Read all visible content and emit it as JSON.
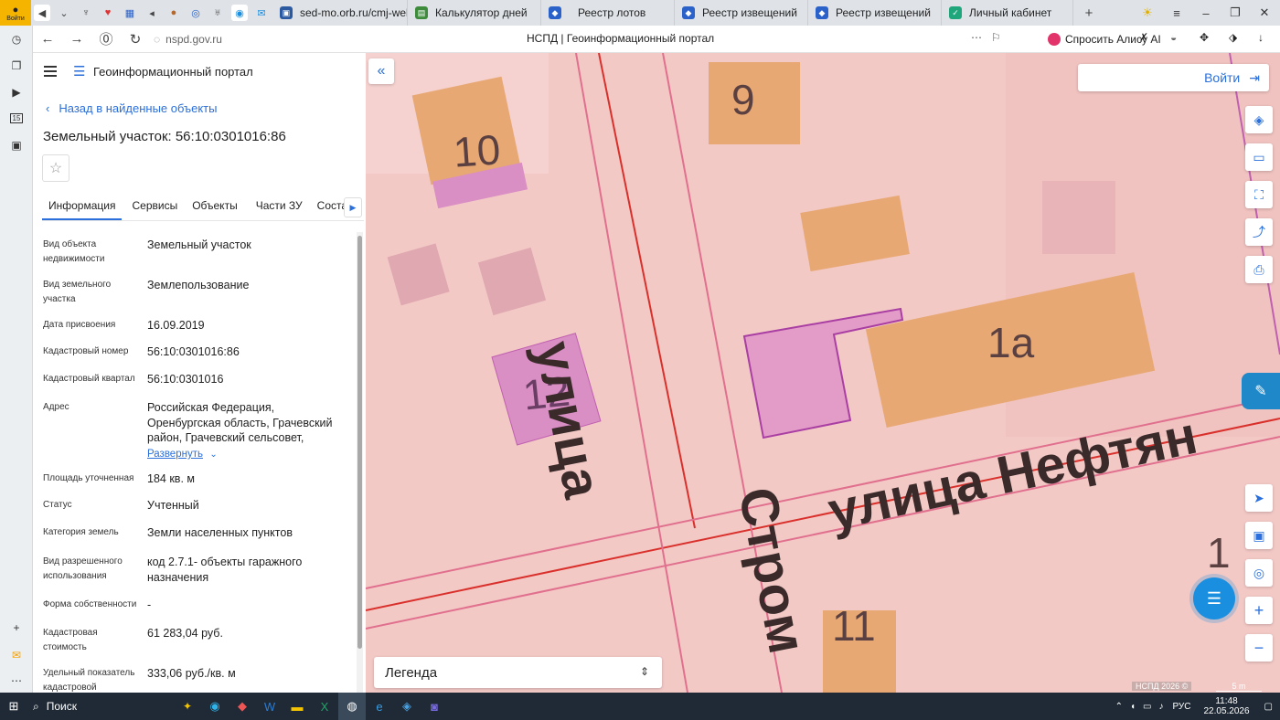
{
  "browser": {
    "profile_label": "Войти",
    "tabs": [
      {
        "label": "sed-mo.orb.ru/cmj-web/?",
        "color": "#2c5aa0"
      },
      {
        "label": "Калькулятор дней",
        "color": "#3c8c3c"
      },
      {
        "label": "Реестр лотов",
        "color": "#2a62c9"
      },
      {
        "label": "Реестр извещений",
        "color": "#2a62c9"
      },
      {
        "label": "Реестр извещений",
        "color": "#2a62c9"
      },
      {
        "label": "Личный кабинет",
        "color": "#1fa67a"
      }
    ],
    "url": "nspd.gov.ru",
    "page_title": "НСПД | Геоинформационный портал",
    "alisa": "Спросить Алису AI",
    "rail_badge": "15"
  },
  "panel": {
    "portal_name": "Геоинформационный портал",
    "back_label": "Назад в найденные объекты",
    "title": "Земельный участок: 56:10:0301016:86",
    "tabs": [
      "Информация",
      "Сервисы",
      "Объекты",
      "Части ЗУ",
      "Состав"
    ],
    "expand_label": "Развернуть",
    "fields": [
      {
        "key": "Вид объекта недвижимости",
        "value": "Земельный участок"
      },
      {
        "key": "Вид земельного участка",
        "value": "Землепользование"
      },
      {
        "key": "Дата присвоения",
        "value": "16.09.2019"
      },
      {
        "key": "Кадастровый номер",
        "value": "56:10:0301016:86"
      },
      {
        "key": "Кадастровый квартал",
        "value": "56:10:0301016"
      },
      {
        "key": "Адрес",
        "value": "Российская Федерация, Оренбургская область, Грачевский район, Грачевский сельсовет,"
      },
      {
        "key": "Площадь уточненная",
        "value": "184 кв. м"
      },
      {
        "key": "Статус",
        "value": "Учтенный"
      },
      {
        "key": "Категория земель",
        "value": "Земли населенных пунктов"
      },
      {
        "key": "Вид разрешенного использования",
        "value": "код 2.7.1- объекты гаражного назначения"
      },
      {
        "key": "Форма собственности",
        "value": "-"
      },
      {
        "key": "Кадастровая стоимость",
        "value": "61 283,04 руб."
      },
      {
        "key": "Удельный показатель кадастровой",
        "value": "333,06 руб./кв. м"
      }
    ]
  },
  "map": {
    "login_label": "Войти",
    "legend_label": "Легенда",
    "copyright": "НСПД 2026 ©",
    "scale_label": "5 m",
    "labels": {
      "n9": "9",
      "n10": "10",
      "n12": "12",
      "n1a": "1а",
      "n11": "11",
      "n1": "1",
      "street1": "улица",
      "street2": "Стром",
      "street3": "улица Нефтян"
    },
    "colors": {
      "base": "#f3c9c6",
      "building": "#e8a874",
      "selected": "#d98ec4",
      "border": "#d9302c"
    }
  },
  "taskbar": {
    "search": "Поиск",
    "lang": "РУС",
    "time": "11:48",
    "date": "22.05.2026"
  }
}
